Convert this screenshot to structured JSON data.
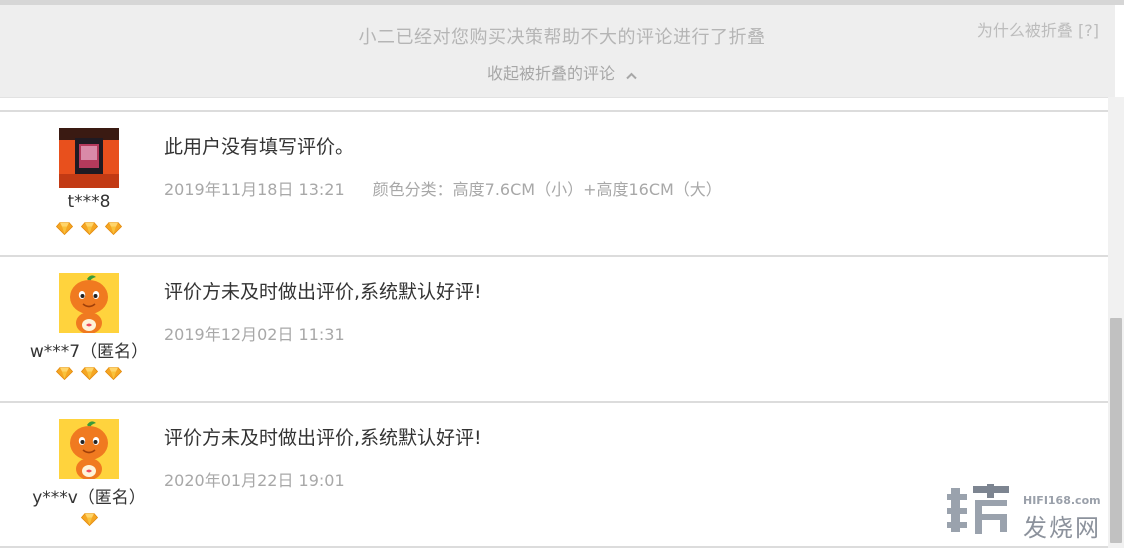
{
  "fold_banner": {
    "message": "小二已经对您购买决策帮助不大的评论进行了折叠",
    "toggle_label": "收起被折叠的评论",
    "why_link": "为什么被折叠 [?]"
  },
  "reviews": [
    {
      "username": "t***8",
      "avatar": "user-photo",
      "rating_gems": 3,
      "text": "此用户没有填写评价。",
      "timestamp": "2019年11月18日 13:21",
      "sku": "颜色分类：高度7.6CM（小）+高度16CM（大）"
    },
    {
      "username": "w***7（匿名）",
      "avatar": "default-mascot",
      "rating_gems": 3,
      "text": "评价方未及时做出评价,系统默认好评!",
      "timestamp": "2019年12月02日 11:31",
      "sku": ""
    },
    {
      "username": "y***v（匿名）",
      "avatar": "default-mascot",
      "rating_gems": 1,
      "text": "评价方未及时做出评价,系统默认好评!",
      "timestamp": "2020年01月22日 19:01",
      "sku": ""
    }
  ],
  "watermark": {
    "domain": "HIFI168.com",
    "name": "发烧网"
  },
  "colors": {
    "banner_bg": "#eeeeee",
    "muted_text": "#b5b5b5",
    "gem_orange": "#f5a623",
    "mascot_orange": "#f07a20"
  },
  "scroll_position": 0.62
}
